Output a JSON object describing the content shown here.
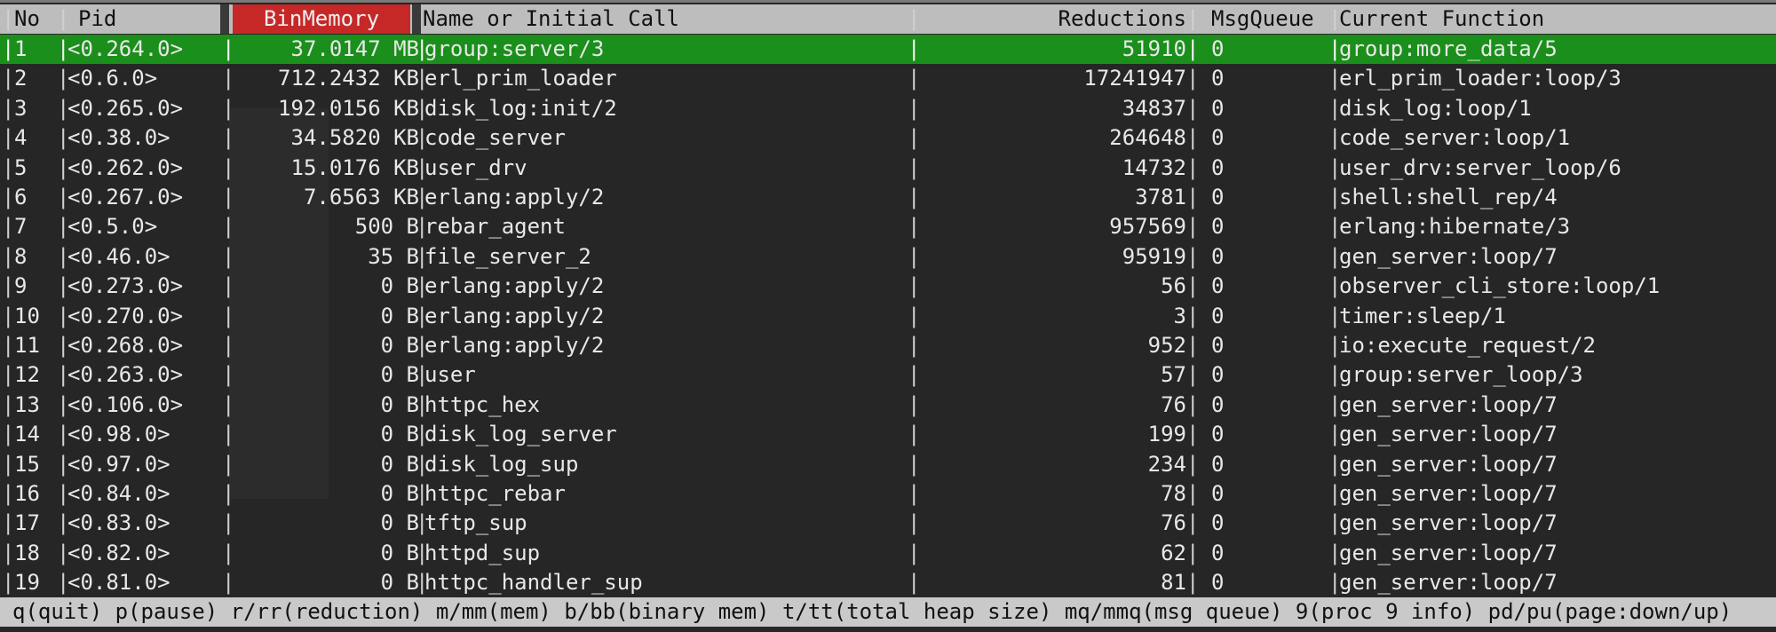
{
  "header": {
    "no": "No",
    "pid": "Pid",
    "binmemory": "BinMemory",
    "name": "Name or Initial Call",
    "reductions": "Reductions",
    "msgqueue": "MsgQueue",
    "current_function": "Current Function"
  },
  "rows": [
    {
      "no": "1",
      "pid": "<0.264.0>",
      "mem": "37.0147 MB",
      "name": "group:server/3",
      "red": "51910",
      "mq": "0",
      "fn": "group:more_data/5"
    },
    {
      "no": "2",
      "pid": "<0.6.0>",
      "mem": "712.2432 KB",
      "name": "erl_prim_loader",
      "red": "17241947",
      "mq": "0",
      "fn": "erl_prim_loader:loop/3"
    },
    {
      "no": "3",
      "pid": "<0.265.0>",
      "mem": "192.0156 KB",
      "name": "disk_log:init/2",
      "red": "34837",
      "mq": "0",
      "fn": "disk_log:loop/1"
    },
    {
      "no": "4",
      "pid": "<0.38.0>",
      "mem": "34.5820 KB",
      "name": "code_server",
      "red": "264648",
      "mq": "0",
      "fn": "code_server:loop/1"
    },
    {
      "no": "5",
      "pid": "<0.262.0>",
      "mem": "15.0176 KB",
      "name": "user_drv",
      "red": "14732",
      "mq": "0",
      "fn": "user_drv:server_loop/6"
    },
    {
      "no": "6",
      "pid": "<0.267.0>",
      "mem": "7.6563 KB",
      "name": "erlang:apply/2",
      "red": "3781",
      "mq": "0",
      "fn": "shell:shell_rep/4"
    },
    {
      "no": "7",
      "pid": "<0.5.0>",
      "mem": "500 B",
      "name": "rebar_agent",
      "red": "957569",
      "mq": "0",
      "fn": "erlang:hibernate/3"
    },
    {
      "no": "8",
      "pid": "<0.46.0>",
      "mem": "35 B",
      "name": "file_server_2",
      "red": "95919",
      "mq": "0",
      "fn": "gen_server:loop/7"
    },
    {
      "no": "9",
      "pid": "<0.273.0>",
      "mem": "0 B",
      "name": "erlang:apply/2",
      "red": "56",
      "mq": "0",
      "fn": "observer_cli_store:loop/1"
    },
    {
      "no": "10",
      "pid": "<0.270.0>",
      "mem": "0 B",
      "name": "erlang:apply/2",
      "red": "3",
      "mq": "0",
      "fn": "timer:sleep/1"
    },
    {
      "no": "11",
      "pid": "<0.268.0>",
      "mem": "0 B",
      "name": "erlang:apply/2",
      "red": "952",
      "mq": "0",
      "fn": "io:execute_request/2"
    },
    {
      "no": "12",
      "pid": "<0.263.0>",
      "mem": "0 B",
      "name": "user",
      "red": "57",
      "mq": "0",
      "fn": "group:server_loop/3"
    },
    {
      "no": "13",
      "pid": "<0.106.0>",
      "mem": "0 B",
      "name": "httpc_hex",
      "red": "76",
      "mq": "0",
      "fn": "gen_server:loop/7"
    },
    {
      "no": "14",
      "pid": "<0.98.0>",
      "mem": "0 B",
      "name": "disk_log_server",
      "red": "199",
      "mq": "0",
      "fn": "gen_server:loop/7"
    },
    {
      "no": "15",
      "pid": "<0.97.0>",
      "mem": "0 B",
      "name": "disk_log_sup",
      "red": "234",
      "mq": "0",
      "fn": "gen_server:loop/7"
    },
    {
      "no": "16",
      "pid": "<0.84.0>",
      "mem": "0 B",
      "name": "httpc_rebar",
      "red": "78",
      "mq": "0",
      "fn": "gen_server:loop/7"
    },
    {
      "no": "17",
      "pid": "<0.83.0>",
      "mem": "0 B",
      "name": "tftp_sup",
      "red": "76",
      "mq": "0",
      "fn": "gen_server:loop/7"
    },
    {
      "no": "18",
      "pid": "<0.82.0>",
      "mem": "0 B",
      "name": "httpd_sup",
      "red": "62",
      "mq": "0",
      "fn": "gen_server:loop/7"
    },
    {
      "no": "19",
      "pid": "<0.81.0>",
      "mem": "0 B",
      "name": "httpc_handler_sup",
      "red": "81",
      "mq": "0",
      "fn": "gen_server:loop/7"
    }
  ],
  "footer": "q(quit) p(pause) r/rr(reduction) m/mm(mem) b/bb(binary mem) t/tt(total heap size) mq/mmq(msg queue) 9(proc 9 info) pd/pu(page:down/up)",
  "colors": {
    "selected": "#1b8f1b",
    "sort_header": "#c62828",
    "header_bg": "#bdbdbd",
    "background": "#262626"
  }
}
